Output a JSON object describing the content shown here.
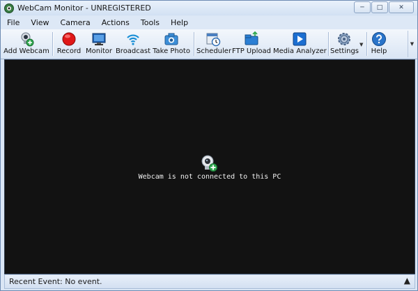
{
  "window": {
    "title": "WebCam Monitor - UNREGISTERED"
  },
  "menu": [
    "File",
    "View",
    "Camera",
    "Actions",
    "Tools",
    "Help"
  ],
  "toolbar": {
    "add_webcam": "Add Webcam",
    "record": "Record",
    "monitor": "Monitor",
    "broadcast": "Broadcast",
    "take_photo": "Take Photo",
    "scheduler": "Scheduler",
    "ftp_upload": "FTP Upload",
    "media_analyzer": "Media Analyzer",
    "settings": "Settings",
    "help": "Help"
  },
  "viewport": {
    "message": "Webcam is not connected to this PC"
  },
  "status": {
    "recent_event": "Recent Event: No event."
  },
  "colors": {
    "viewport_bg": "#121212",
    "window_frame": "#dae6f5",
    "accent": "#1c6fd1"
  }
}
